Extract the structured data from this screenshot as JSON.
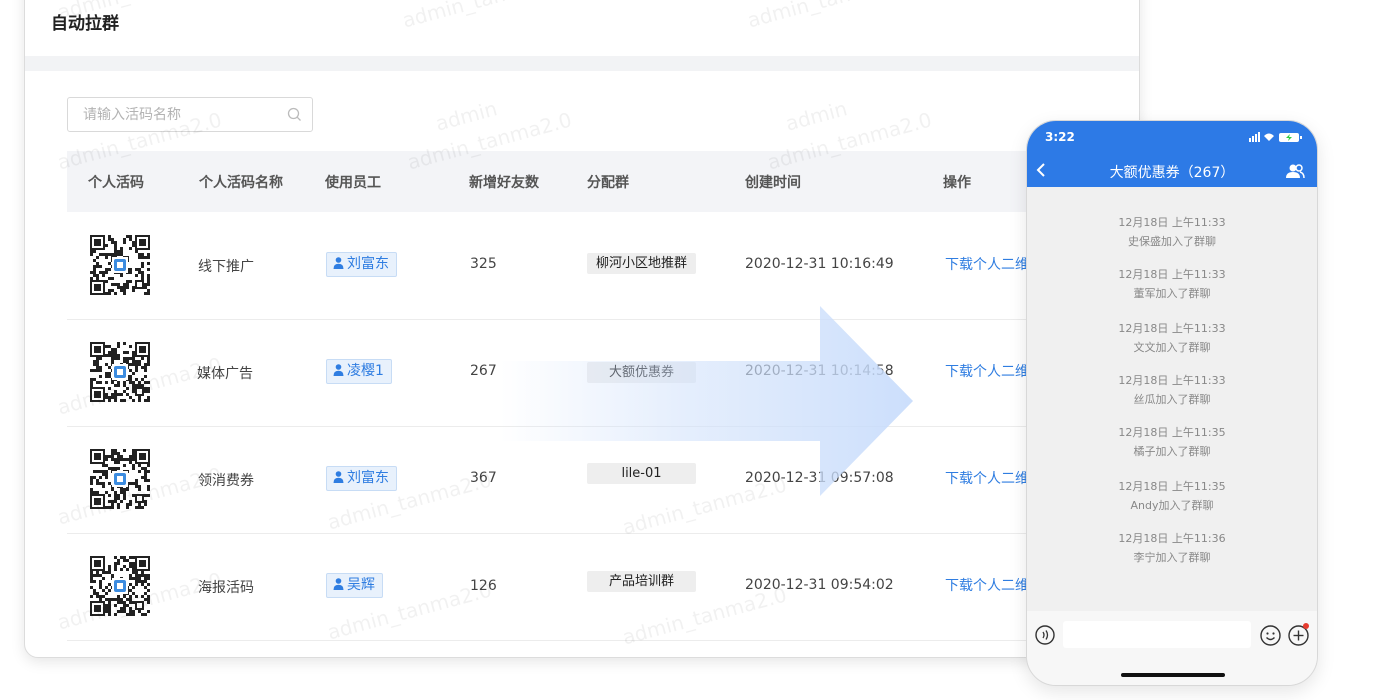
{
  "page_title": "自动拉群",
  "search": {
    "placeholder": "请输入活码名称"
  },
  "table": {
    "headers": [
      "个人活码",
      "个人活码名称",
      "使用员工",
      "新增好友数",
      "分配群",
      "创建时间",
      "操作"
    ],
    "rows": [
      {
        "name": "线下推广",
        "employee": "刘富东",
        "new_friends": "325",
        "group": "柳河小区地推群",
        "created": "2020-12-31 10:16:49",
        "action": "下载个人二维"
      },
      {
        "name": "媒体广告",
        "employee": "凌樱1",
        "new_friends": "267",
        "group": "大额优惠券",
        "created": "2020-12-31 10:14:58",
        "action": "下载个人二维"
      },
      {
        "name": "领消费券",
        "employee": "刘富东",
        "new_friends": "367",
        "group": "lile-01",
        "created": "2020-12-31 09:57:08",
        "action": "下载个人二维"
      },
      {
        "name": "海报活码",
        "employee": "吴辉",
        "new_friends": "126",
        "group": "产品培训群",
        "created": "2020-12-31 09:54:02",
        "action": "下载个人二维"
      }
    ]
  },
  "watermark": [
    "admin",
    "admin_tanma2.0"
  ],
  "phone": {
    "status_time": "3:22",
    "chat_title": "大额优惠券（267）",
    "messages": [
      {
        "time": "12月18日 上午11:33",
        "text": "史保盛加入了群聊"
      },
      {
        "time": "12月18日 上午11:33",
        "text": "董军加入了群聊"
      },
      {
        "time": "12月18日 上午11:33",
        "text": "文文加入了群聊"
      },
      {
        "time": "12月18日 上午11:33",
        "text": "丝瓜加入了群聊"
      },
      {
        "time": "12月18日 上午11:35",
        "text": "橘子加入了群聊"
      },
      {
        "time": "12月18日 上午11:35",
        "text": "Andy加入了群聊"
      },
      {
        "time": "12月18日 上午11:36",
        "text": "李宁加入了群聊"
      }
    ]
  },
  "colors": {
    "accent": "#2f7de1",
    "phone_header": "#2d7ae6",
    "header_bg": "#f3f4f7"
  },
  "icons": [
    "search-icon",
    "person-icon",
    "qr-code-icon",
    "back-icon",
    "members-icon",
    "voice-icon",
    "emoji-icon",
    "plus-icon"
  ]
}
